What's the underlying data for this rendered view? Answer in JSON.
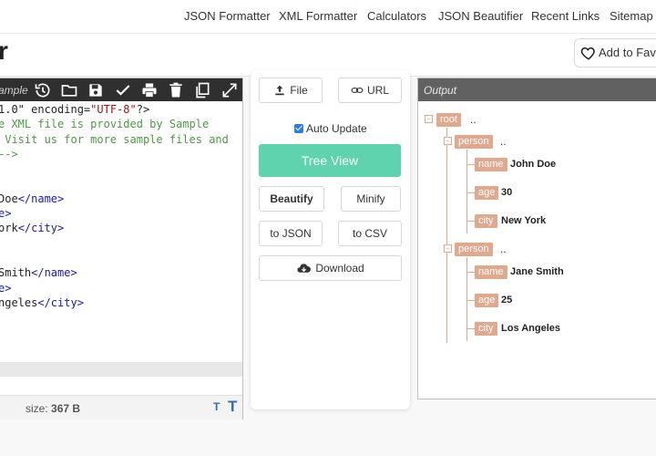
{
  "nav": {
    "items": [
      "JSON Formatter",
      "XML Formatter",
      "Calculators",
      "JSON Beautifier",
      "Recent Links",
      "Sitemap"
    ]
  },
  "header": {
    "title_fragment": "r",
    "fav_label": "Add to Fav"
  },
  "editor": {
    "sample_label": "ample",
    "lines": [
      {
        "parts": [
          {
            "t": "1.0\" encoding=",
            "c": ""
          },
          {
            "t": "\"UTF-8\"",
            "c": "st"
          },
          {
            "t": "?>",
            "c": ""
          }
        ]
      },
      {
        "parts": [
          {
            "t": "e XML file is provided by Sample",
            "c": "cm"
          }
        ]
      },
      {
        "parts": [
          {
            "t": " Visit us for more sample files and",
            "c": "cm"
          }
        ]
      },
      {
        "parts": [
          {
            "t": "-->",
            "c": "cm"
          }
        ]
      },
      {
        "parts": []
      },
      {
        "parts": []
      },
      {
        "parts": [
          {
            "t": "Doe",
            "c": ""
          },
          {
            "t": "</name>",
            "c": "tg"
          }
        ]
      },
      {
        "parts": [
          {
            "t": "e>",
            "c": "tg"
          }
        ]
      },
      {
        "parts": [
          {
            "t": "ork",
            "c": ""
          },
          {
            "t": "</city>",
            "c": "tg"
          }
        ]
      },
      {
        "parts": []
      },
      {
        "parts": []
      },
      {
        "parts": [
          {
            "t": "Smith",
            "c": ""
          },
          {
            "t": "</name>",
            "c": "tg"
          }
        ]
      },
      {
        "parts": [
          {
            "t": "e>",
            "c": "tg"
          }
        ]
      },
      {
        "parts": [
          {
            "t": "ngeles",
            "c": ""
          },
          {
            "t": "</city>",
            "c": "tg"
          }
        ]
      }
    ],
    "size_label": "size: ",
    "size_value": "367 B",
    "font_small": "T",
    "font_large": "T"
  },
  "middle": {
    "file_label": "File",
    "url_label": "URL",
    "auto_update_label": "Auto Update",
    "tree_view_label": "Tree View",
    "beautify_label": "Beautify",
    "minify_label": "Minify",
    "to_json_label": "to JSON",
    "to_csv_label": "to CSV",
    "download_label": "Download"
  },
  "output": {
    "header": "Output",
    "root_label": "root",
    "dots": "..",
    "persons": [
      {
        "label": "person",
        "fields": [
          {
            "key": "name",
            "value": "John Doe"
          },
          {
            "key": "age",
            "value": "30"
          },
          {
            "key": "city",
            "value": "New York"
          }
        ]
      },
      {
        "label": "person",
        "fields": [
          {
            "key": "name",
            "value": "Jane Smith"
          },
          {
            "key": "age",
            "value": "25"
          },
          {
            "key": "city",
            "value": "Los Angeles"
          }
        ]
      }
    ]
  },
  "colors": {
    "tree_button": "#5fd3ad",
    "node_tag": "#e0a98e",
    "toolbar": "#2f2f2f",
    "output_header": "#616161"
  }
}
